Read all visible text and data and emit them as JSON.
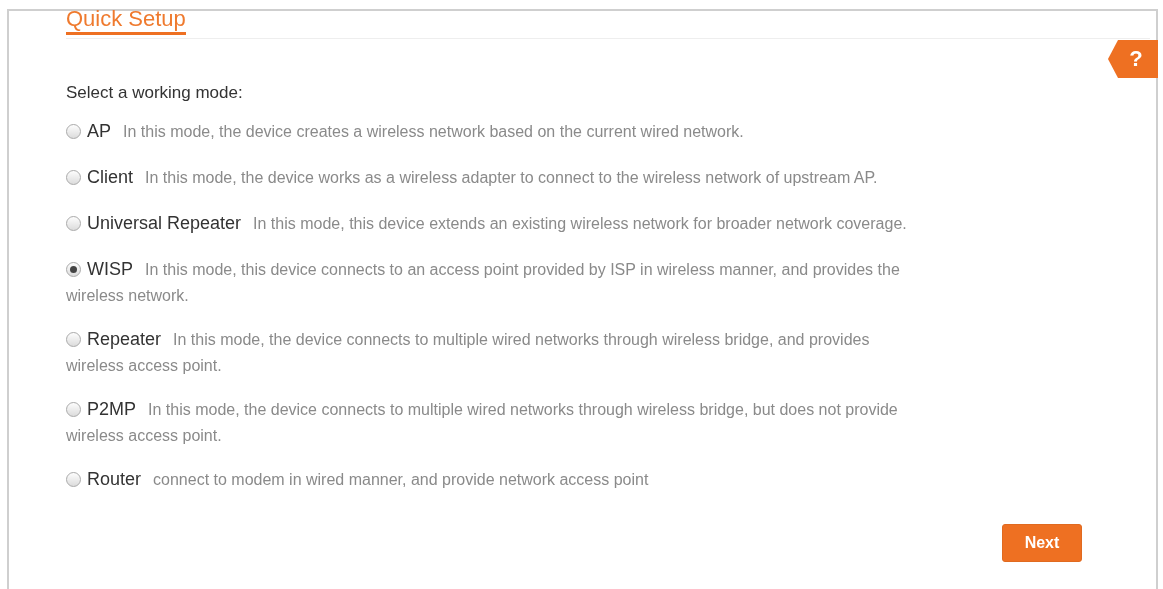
{
  "title": "Quick Setup",
  "help": "?",
  "prompt": "Select a working mode:",
  "modes": [
    {
      "label": "AP",
      "description_lines": [
        "In this mode, the device creates a wireless network based on the current wired network."
      ],
      "selected": false
    },
    {
      "label": "Client",
      "description_lines": [
        "In this mode, the device works as a wireless adapter to connect to the wireless network of upstream AP."
      ],
      "selected": false
    },
    {
      "label": "Universal Repeater",
      "description_lines": [
        "In this mode, this device extends an existing wireless network for broader network coverage."
      ],
      "selected": false
    },
    {
      "label": "WISP",
      "description_lines": [
        "In this mode, this device connects to an access point provided by ISP in wireless manner, and provides the",
        "wireless network."
      ],
      "selected": true
    },
    {
      "label": "Repeater",
      "description_lines": [
        "In this mode, the device connects to multiple wired networks through wireless bridge, and provides",
        "wireless access point."
      ],
      "selected": false
    },
    {
      "label": "P2MP",
      "description_lines": [
        "In this mode, the device connects to multiple wired networks through wireless bridge, but does not provide",
        "wireless access point."
      ],
      "selected": false
    },
    {
      "label": "Router",
      "description_lines": [
        "connect to modem in wired manner, and provide network access point"
      ],
      "selected": false
    }
  ],
  "next_button": "Next"
}
